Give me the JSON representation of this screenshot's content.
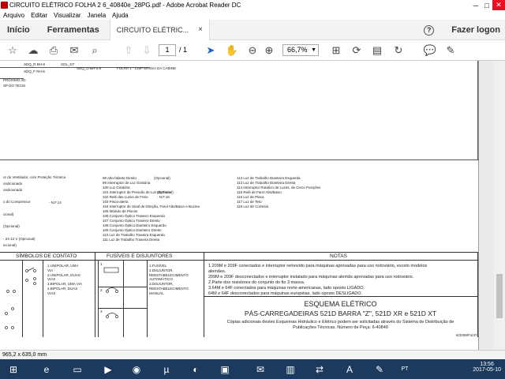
{
  "window": {
    "title": "CIRCUITO ELÉTRICO FOLHA 2 6_40840e_28PG.pdf - Adobe Acrobat Reader DC"
  },
  "menu": [
    "Arquivo",
    "Editar",
    "Visualizar",
    "Janela",
    "Ajuda"
  ],
  "tabs": {
    "home": "Início",
    "tools": "Ferramentas",
    "doc": "CIRCUITO ELÉTRIC...",
    "login": "Fazer logon"
  },
  "toolbar": {
    "page": "1",
    "page_total": "/ 1",
    "zoom": "66,7%"
  },
  "drawing": {
    "top_labels": [
      "SDQ_R BH-8",
      "SDQ_F RH-8",
      "SOL_D7",
      "SDQ_O BH-0.8",
      "FOLHA 1 - 215P MASSA DA CABINE",
      "PRÓXIMO AD",
      "SP DO TECM"
    ],
    "col1": [
      "or do Ventilador, com Proteção Térmica",
      "ondicionado",
      "ondicionado",
      "",
      "o do Compressor",
      "",
      "cional)",
      "",
      "(Opcional)",
      "",
      "- 24-12 V (Opcional)",
      "incional)"
    ],
    "col1b": [
      "- N.F.14"
    ],
    "col2": [
      "98 Alto-falante Direito",
      "99 Interruptor de Luz Giratória",
      "100 Luz Giratória",
      "101 Interruptor de Pressão de Luz de Freio",
      "102 Relé das Luzes de Freio",
      "103 Pisca-alerta",
      "104 Interruptor de Sinal de Direção, Farol Alto/Baixo e Buzina",
      "105 Módulo de Piscas",
      "106 Conjunto Óptico Traseiro Esquerdo",
      "107 Conjunto Óptico Traseiro Direito",
      "108 Conjunto Óptico Dianteiro Esquerdo",
      "109 Conjunto Óptico Dianteiro Direito",
      "110 Luz de Trabalho Traseira Esquerda",
      "111 Luz de Trabalho Traseira Direita"
    ],
    "col2b": [
      "(Opcional)",
      "- N.F.15",
      "(Opcional)"
    ],
    "col3": [
      "112 Luz de Trabalho Dianteira Esquerda",
      "113 Luz de Trabalho Dianteira Direita",
      "114 Interruptor Rotativo de Luzes, de Cinco Posições",
      "115 Relé de Farol Alto/Baixo",
      "116 Luz de Placa",
      "117 Luz de Teto",
      "118 Luz de Cortesia"
    ]
  },
  "legend": {
    "contact_title": "SÍMBOLOS DE CONTATO",
    "fuse_title": "FUSÍVEIS E DISJUNTORES",
    "notes_title": "NOTAS",
    "contact_items": [
      "1.UNIPOLAR, UMA",
      "VIA",
      "2.UNIPOLAR, DUAS",
      "VIAS",
      "3.BIPOLAR, UMA VIA",
      "4.BIPOLAR, DUAS",
      "VIAS"
    ],
    "fuse_items": [
      "1.FUSÍVEL",
      "2.DISJUNTOR,",
      "REESTABELECIMENTO",
      "AUTOMÁTICO",
      "3.DISJUNTOR,",
      "REESTABELECIMENTO",
      "MANUAL"
    ],
    "fuse_nums": [
      "1",
      "2",
      "3"
    ],
    "notes": [
      "1.209M e 209F conectados e interruptor removido para máquinas aprovadas para uso rodoviário, exceto modelos",
      "alemães.",
      "209M e 209F desconectados e interruptor instalado para máquinas alemãs aprovadas para uso rodoviário.",
      "2.Parte dos resistores do conjunto do fio 3 massa.",
      "3.64M e 64F conectados para máquinas norte-americanas, lado oposto LIGADO.",
      "64M e 64F desconectados para máquinas européias, lado oposto DESLIGADO."
    ],
    "title1": "ESQUEMA ELÉTRICO",
    "title2": "PÁS-CARREGADEIRAS 521D BARRA \"Z\", 521D XR e 521D XT",
    "copy": "Cópias adicionais destes Esquemas Hidráulico e Elétrico podem ser solicitadas através do Sistema de Distribuição de",
    "copy2": "Publicações Técnicas. Número de Peça: 6-40840",
    "stamp": "6/2009/F4/47"
  },
  "status": {
    "size": "965,2 x 635,0 mm"
  },
  "tray": {
    "lang": "PT",
    "time": "13:56",
    "date": "2017-05-10"
  }
}
